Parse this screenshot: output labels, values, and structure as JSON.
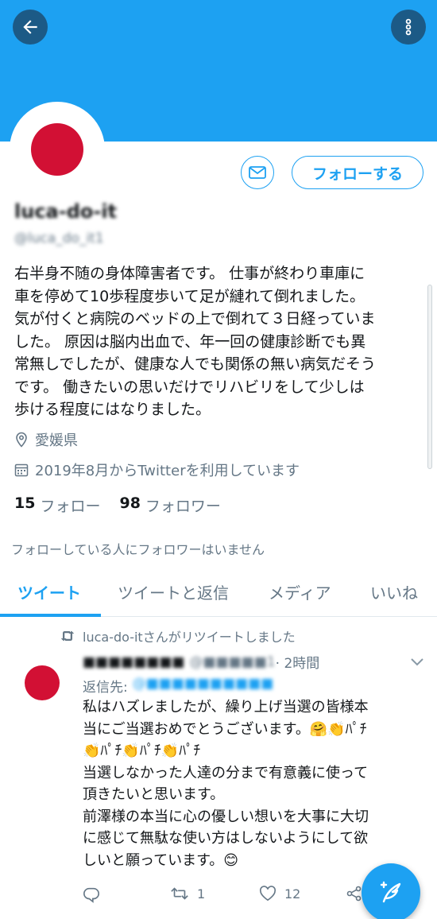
{
  "profile": {
    "display_name": "luca-do-it",
    "handle": "@luca_do_it1",
    "follow_label": "フォローする",
    "bio": "右半身不随の身体障害者です。 仕事が終わり車庫に\n車を停めて10歩程度歩いて足が縺れて倒れました。\n気が付くと病院のベッドの上で倒れて３日経っていま\nした。 原因は脳内出血で、年一回の健康診断でも異\n常無しでしたが、健康な人でも関係の無い病気だそう\nです。 働きたいの思いだけでリハビリをして少しは\n歩ける程度にはなりました。",
    "location": "愛媛県",
    "joined": "2019年8月からTwitterを利用しています",
    "following_count": "15",
    "following_label": "フォロー",
    "followers_count": "98",
    "followers_label": "フォロワー",
    "known_followers_note": "フォローしている人にフォロワーはいません"
  },
  "tabs": [
    {
      "label": "ツイート",
      "active": true
    },
    {
      "label": "ツイートと返信",
      "active": false
    },
    {
      "label": "メディア",
      "active": false
    },
    {
      "label": "いいね",
      "active": false
    }
  ],
  "tweet": {
    "retweet_context": "luca-do-itさんがリツイートしました",
    "author_name": "■■■■■■■■",
    "author_handle": "@■■■■■1",
    "time": "· 2時間",
    "reply_label": "返信先:",
    "reply_target": "@■■■■■■■■■■",
    "text": "私はハズレましたが、繰り上げ当選の皆様本\n当にご当選おめでとうございます。🤗👏ﾊﾟﾁ\n👏ﾊﾟﾁ👏ﾊﾟﾁ👏ﾊﾟﾁ\n当選しなかった人達の分まで有意義に使って\n頂きたいと思います。\n前澤様の本当に心の優しい想いを大事に大切\nに感じて無駄な使い方はしないようにして欲\nしいと願っています。😊",
    "retweets": "1",
    "likes": "12"
  },
  "colors": {
    "accent": "#1da1f2",
    "header_button": "#1c5a86",
    "avatar_sun": "#d21034",
    "secondary_text": "#657786"
  },
  "icons": [
    "back-arrow-icon",
    "more-vertical-icon",
    "mail-icon",
    "location-pin-icon",
    "calendar-icon",
    "retweet-icon",
    "chevron-down-icon",
    "reply-icon",
    "like-icon",
    "share-icon",
    "compose-tweet-icon"
  ]
}
